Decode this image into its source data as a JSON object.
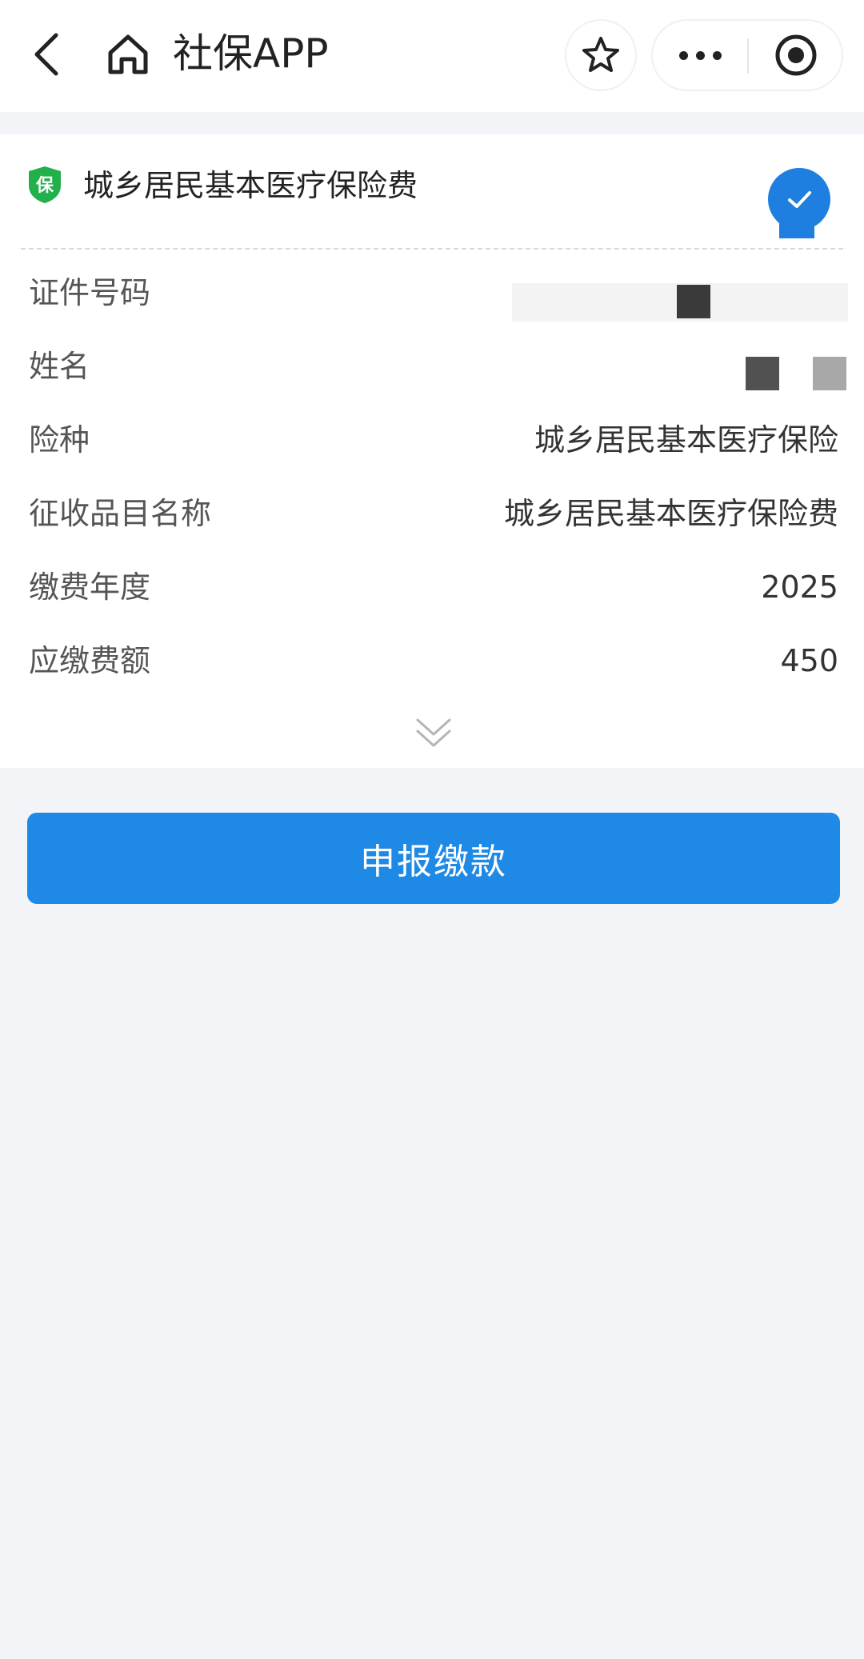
{
  "nav": {
    "title": "社保APP"
  },
  "card": {
    "badge_text": "保",
    "title": "城乡居民基本医疗保险费",
    "selected": true,
    "rows": [
      {
        "label": "证件号码",
        "value": ""
      },
      {
        "label": "姓名",
        "value": ""
      },
      {
        "label": "险种",
        "value": "城乡居民基本医疗保险"
      },
      {
        "label": "征收品目名称",
        "value": "城乡居民基本医疗保险费"
      },
      {
        "label": "缴费年度",
        "value": "2025"
      },
      {
        "label": "应缴费额",
        "value": "450"
      }
    ]
  },
  "actions": {
    "submit_label": "申报缴款"
  },
  "colors": {
    "primary": "#1e8ae6",
    "check": "#1e7fe0",
    "badge": "#22b04b",
    "page_bg": "#f2f4f8"
  },
  "icons": {
    "back": "chevron-left-icon",
    "home": "home-icon",
    "favorite": "star-icon",
    "more": "more-dots-icon",
    "target": "target-icon",
    "badge": "shield-icon",
    "check": "check-icon",
    "expand": "double-chevron-down-icon"
  }
}
